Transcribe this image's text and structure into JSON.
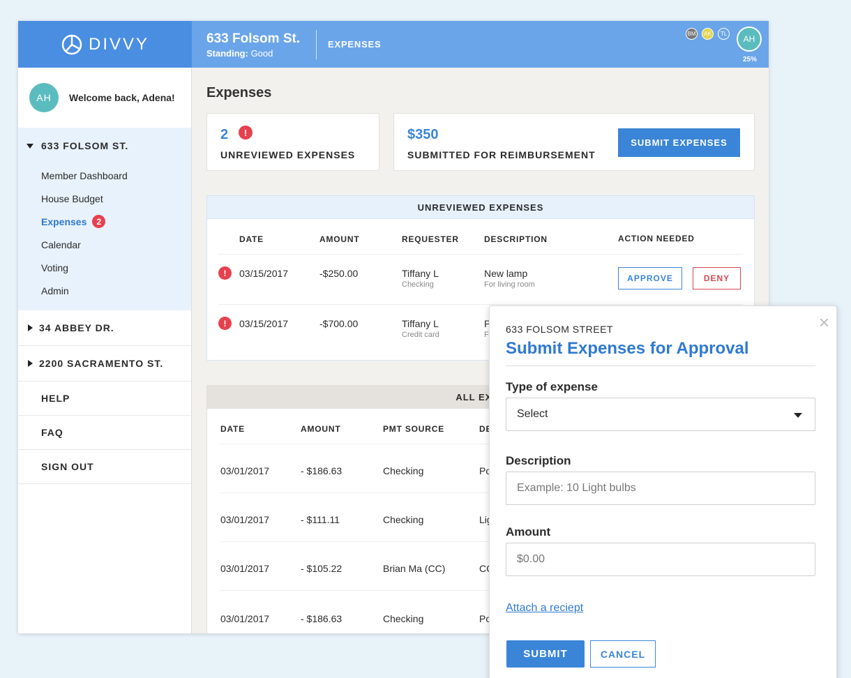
{
  "brand": {
    "name": "DIVVY"
  },
  "header": {
    "house_name": "633 Folsom St.",
    "standing_label": "Standing:",
    "standing_value": "Good",
    "section": "EXPENSES",
    "members": [
      {
        "initials": "BM",
        "color": "#777777"
      },
      {
        "initials": "AK",
        "color": "#e3d44a"
      },
      {
        "initials": "TL",
        "color": "#6aa5ea"
      }
    ],
    "user_initials": "AH",
    "progress_label": "25%"
  },
  "sidebar": {
    "avatar": "AH",
    "welcome": "Welcome back, Adena!",
    "active_house": "633 FOLSOM ST.",
    "nav": [
      {
        "label": "Member Dashboard"
      },
      {
        "label": "House Budget"
      },
      {
        "label": "Expenses",
        "badge": "2"
      },
      {
        "label": "Calendar"
      },
      {
        "label": "Voting"
      },
      {
        "label": "Admin"
      }
    ],
    "other_houses": [
      "34 ABBEY DR.",
      "2200 SACRAMENTO ST."
    ],
    "links": [
      "HELP",
      "FAQ",
      "SIGN OUT"
    ]
  },
  "main": {
    "title": "Expenses",
    "unreviewed_count": "2",
    "unreviewed_label": "UNREVIEWED EXPENSES",
    "submitted_amount": "$350",
    "submitted_label": "SUBMITTED FOR REIMBURSEMENT",
    "submit_button": "SUBMIT EXPENSES"
  },
  "unreviewed_table": {
    "title": "UNREVIEWED EXPENSES",
    "columns": [
      "DATE",
      "AMOUNT",
      "REQUESTER",
      "DESCRIPTION",
      "ACTION NEEDED"
    ],
    "rows": [
      {
        "date": "03/15/2017",
        "amount": "-$250.00",
        "requester": "Tiffany L",
        "source": "Checking",
        "description": "New lamp",
        "note": "For living room"
      },
      {
        "date": "03/15/2017",
        "amount": "-$700.00",
        "requester": "Tiffany L",
        "source": "Credit card",
        "description": "P",
        "note": "F"
      }
    ],
    "approve": "APPROVE",
    "deny": "DENY"
  },
  "all_table": {
    "title": "ALL EXPE",
    "columns": [
      "DATE",
      "AMOUNT",
      "PMT SOURCE",
      "DE"
    ],
    "rows": [
      {
        "date": "03/01/2017",
        "amount": "- $186.63",
        "source": "Checking",
        "desc": "Po"
      },
      {
        "date": "03/01/2017",
        "amount": "- $111.11",
        "source": "Checking",
        "desc": "Lig"
      },
      {
        "date": "03/01/2017",
        "amount": "- $105.22",
        "source": "Brian Ma (CC)",
        "desc": "CC"
      },
      {
        "date": "03/01/2017",
        "amount": "- $186.63",
        "source": "Checking",
        "desc": "Po"
      }
    ]
  },
  "modal": {
    "close": "×",
    "subtitle": "633 FOLSOM STREET",
    "title": "Submit Expenses for Approval",
    "type_label": "Type of expense",
    "type_value": "Select",
    "description_label": "Description",
    "description_placeholder": "Example: 10 Light bulbs",
    "amount_label": "Amount",
    "amount_placeholder": "$0.00",
    "attach_link": "Attach a reciept",
    "submit": "SUBMIT",
    "cancel": "CANCEL"
  },
  "colors": {
    "primary": "#3a85d8",
    "header": "#6aa5ea",
    "danger": "#e5414f",
    "avatar": "#5bbcbf"
  }
}
